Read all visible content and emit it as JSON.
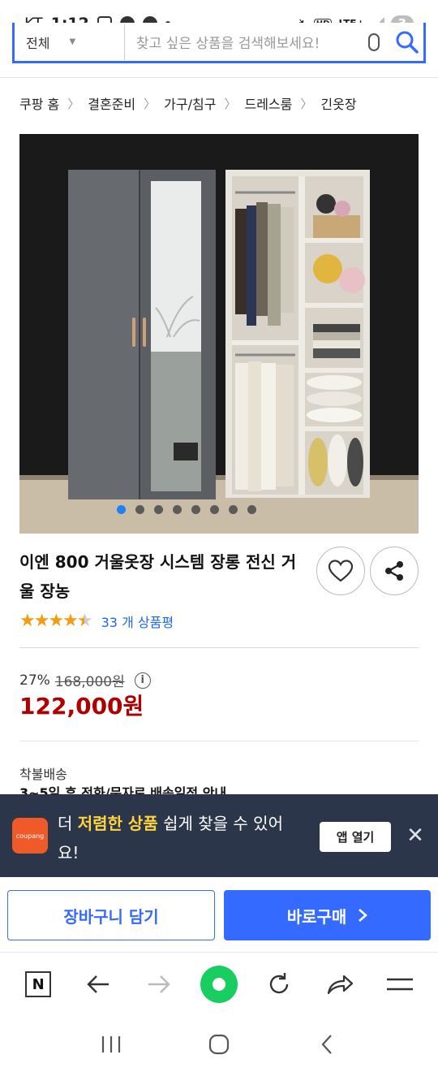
{
  "status_bar": {
    "carrier": "KT",
    "time": "1:12",
    "hd": "HD",
    "network": "LTE+",
    "battery_badge": "3"
  },
  "search": {
    "category": "전체",
    "placeholder": "찾고 싶은 상품을 검색해보세요!"
  },
  "breadcrumb": [
    "쿠팡 홈",
    "결혼준비",
    "가구/침구",
    "드레스룸",
    "긴옷장"
  ],
  "gallery": {
    "dot_count": 8,
    "active_index": 0
  },
  "product": {
    "title": "이엔 800 거울옷장 시스템 장롱 전신 거울 장농",
    "rating": 4.5,
    "review_text": "33 개 상품평"
  },
  "price": {
    "discount": "27%",
    "original": "168,000원",
    "sale": "122,000원"
  },
  "shipping": {
    "label": "착불배송",
    "eta": "3~5일 후 전화/문자로 배송일정 안내"
  },
  "app_banner": {
    "logo_text": "coupang",
    "text_pre": "더 ",
    "text_highlight": "저렴한 상품",
    "text_post": " 쉽게 찾을 수 있어요!",
    "open_label": "앱 열기"
  },
  "actions": {
    "cart_label": "장바구니 담기",
    "buy_label": "바로구매"
  },
  "colors": {
    "accent": "#346aff",
    "sale_red": "#ae0000",
    "banner_bg": "#2b364a",
    "highlight": "#ffd23f",
    "star": "#f39c12",
    "naver_green": "#19ce60"
  },
  "icons": {
    "wishlist": "heart-icon",
    "share": "share-icon",
    "search": "magnifier-icon",
    "mic": "mic-icon"
  }
}
